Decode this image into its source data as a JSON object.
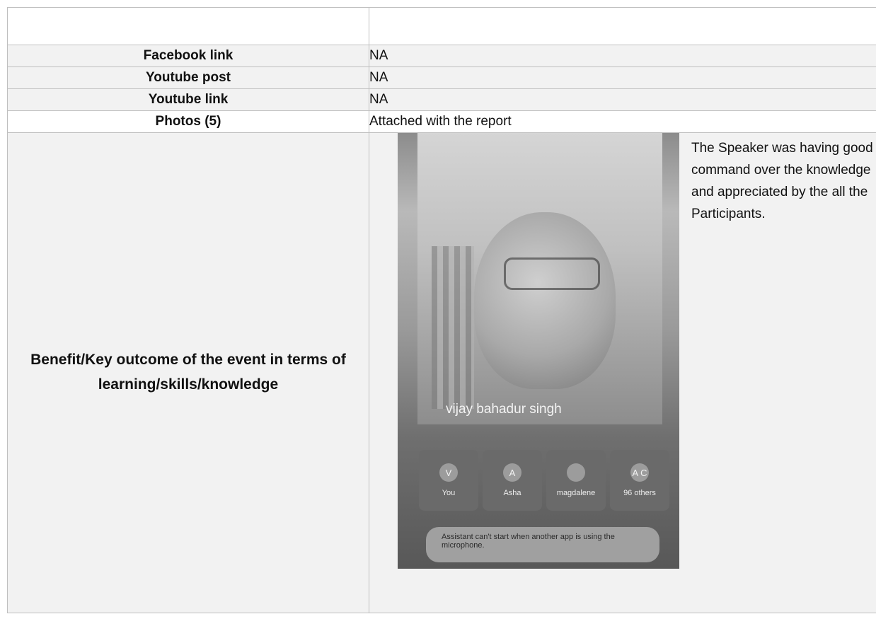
{
  "rows": [
    {
      "label": "",
      "value": ""
    },
    {
      "label": "Facebook link",
      "value": "NA"
    },
    {
      "label": "Youtube post",
      "value": "NA"
    },
    {
      "label": "Youtube link",
      "value": "NA"
    },
    {
      "label": "Photos (5)",
      "value": "Attached with the report"
    }
  ],
  "benefit": {
    "label": "Benefit/Key outcome of the event in terms of learning/skills/knowledge",
    "caption": "The Speaker was having good command over the knowledge and appreciated by the all the Participants.",
    "photo": {
      "speaker_name": "vijay bahadur singh",
      "participants": [
        {
          "initial": "V",
          "name": "You"
        },
        {
          "initial": "A",
          "name": "Asha"
        },
        {
          "initial": "",
          "name": "magdalene"
        },
        {
          "initial": "A C",
          "name": "96 others"
        }
      ],
      "toast": "Assistant can't start when another app is using the microphone."
    }
  }
}
